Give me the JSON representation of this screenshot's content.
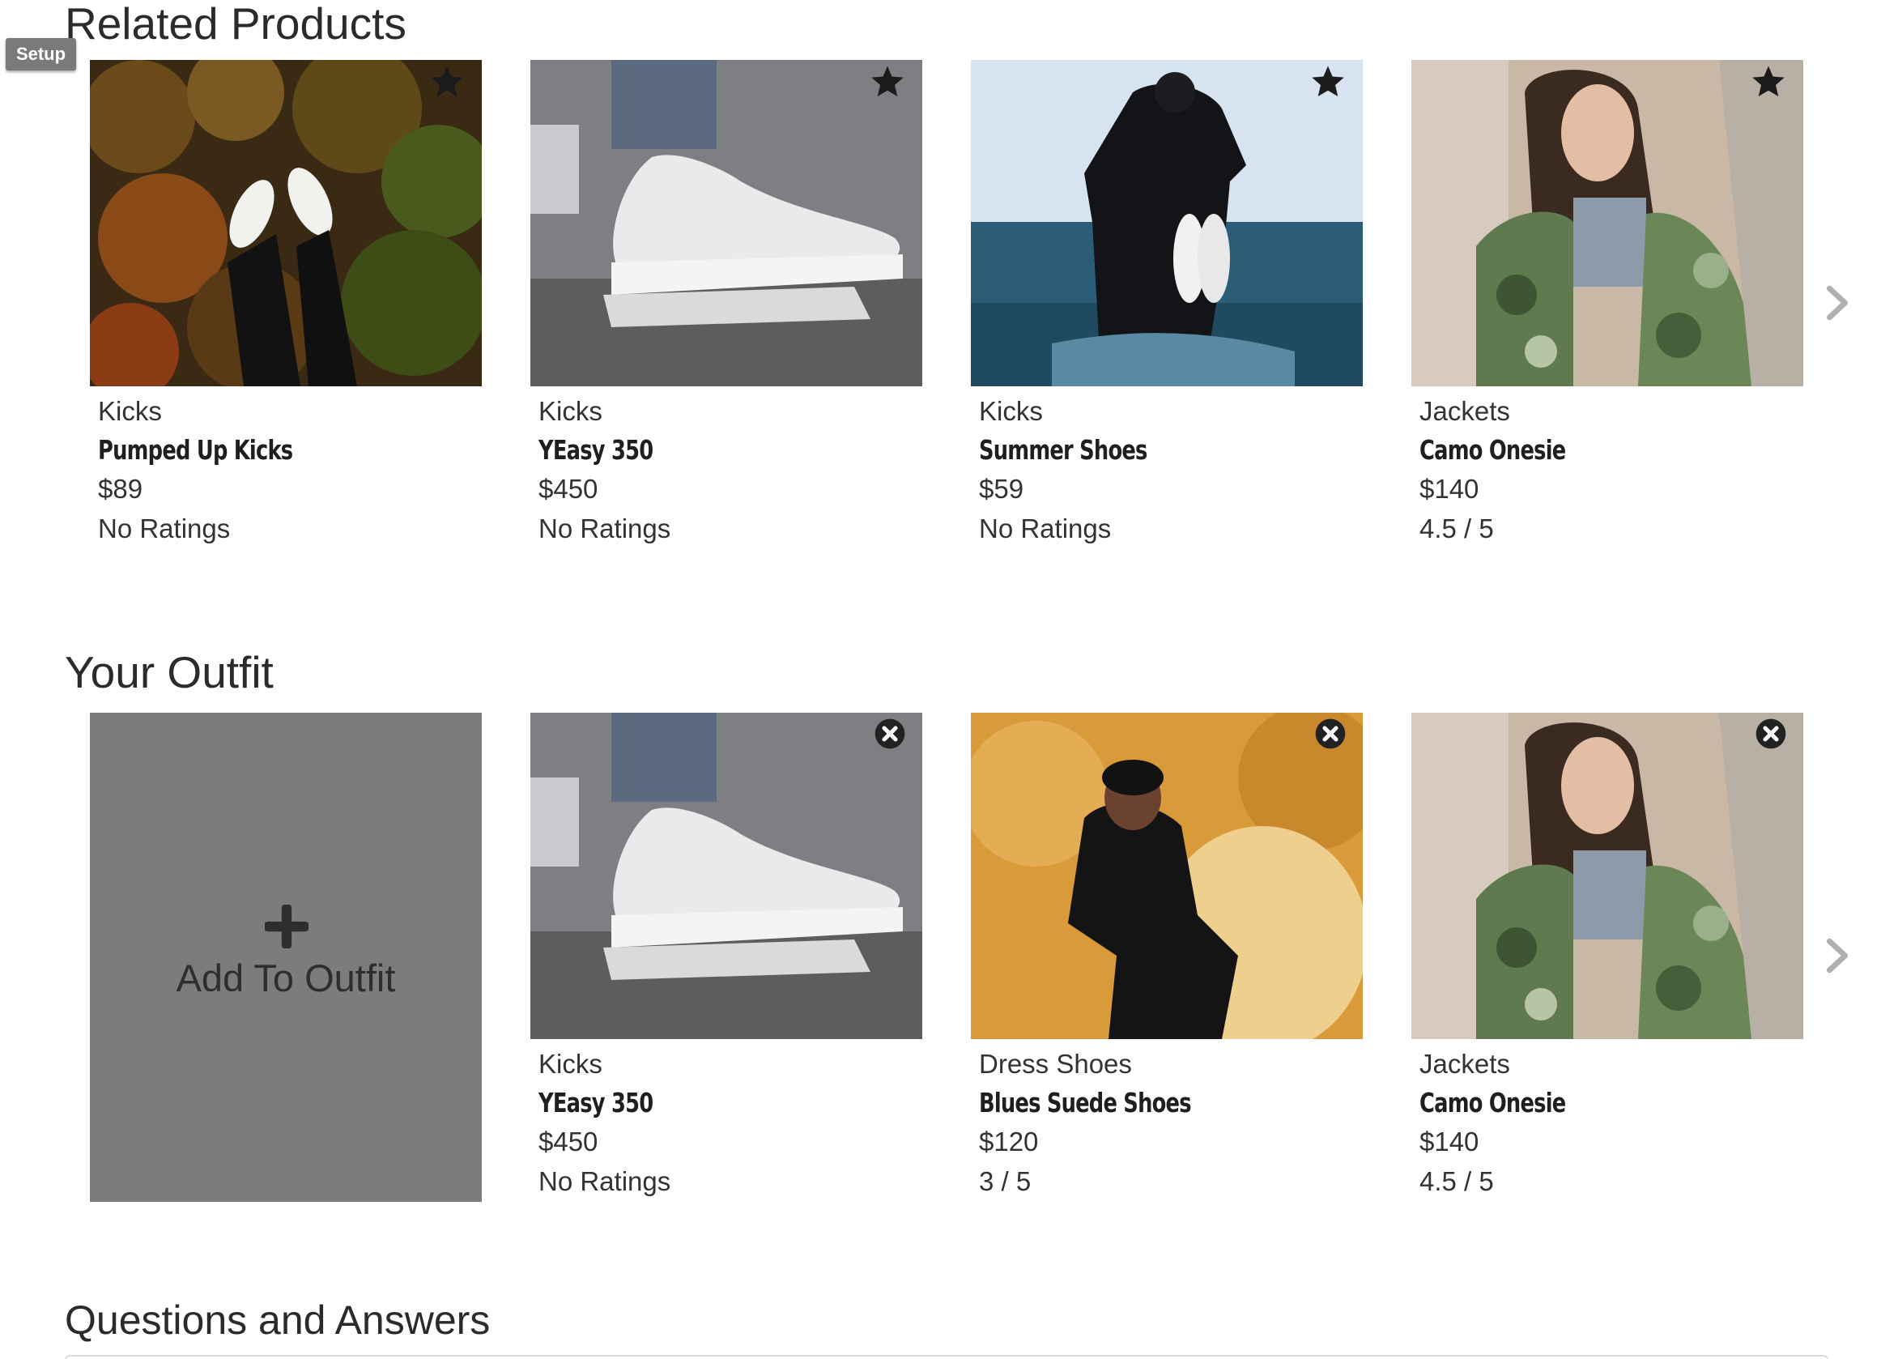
{
  "setup_button": {
    "label": "Setup"
  },
  "related": {
    "title": "Related Products",
    "cards": [
      {
        "category": "Kicks",
        "name": "Pumped Up Kicks",
        "price": "$89",
        "rating": "No Ratings",
        "image": "sneakers-over-autumn-forest"
      },
      {
        "category": "Kicks",
        "name": "YEasy 350",
        "price": "$450",
        "rating": "No Ratings",
        "image": "white-sneaker-closeup"
      },
      {
        "category": "Kicks",
        "name": "Summer Shoes",
        "price": "$59",
        "rating": "No Ratings",
        "image": "person-in-sea-holding-shoes"
      },
      {
        "category": "Jackets",
        "name": "Camo Onesie",
        "price": "$140",
        "rating": "4.5 / 5",
        "image": "woman-in-camo-jacket"
      }
    ],
    "card_icon": "star-icon",
    "next_icon": "chevron-right-icon"
  },
  "outfit": {
    "title": "Your Outfit",
    "add_label": "Add To Outfit",
    "add_icon": "plus-icon",
    "cards": [
      {
        "category": "Kicks",
        "name": "YEasy 350",
        "price": "$450",
        "rating": "No Ratings",
        "image": "white-sneaker-closeup"
      },
      {
        "category": "Dress Shoes",
        "name": "Blues Suede Shoes",
        "price": "$120",
        "rating": "3 / 5",
        "image": "man-on-fur-chair"
      },
      {
        "category": "Jackets",
        "name": "Camo Onesie",
        "price": "$140",
        "rating": "4.5 / 5",
        "image": "woman-in-camo-jacket"
      }
    ],
    "card_icon": "close-circle-icon",
    "next_icon": "chevron-right-icon"
  },
  "qa": {
    "title": "Questions and Answers"
  },
  "colors": {
    "title_text": "#2b2b2b",
    "add_card_bg": "#7c7c7c",
    "icon_dark": "#1f1f1f",
    "chevron": "#b0b0b0"
  }
}
